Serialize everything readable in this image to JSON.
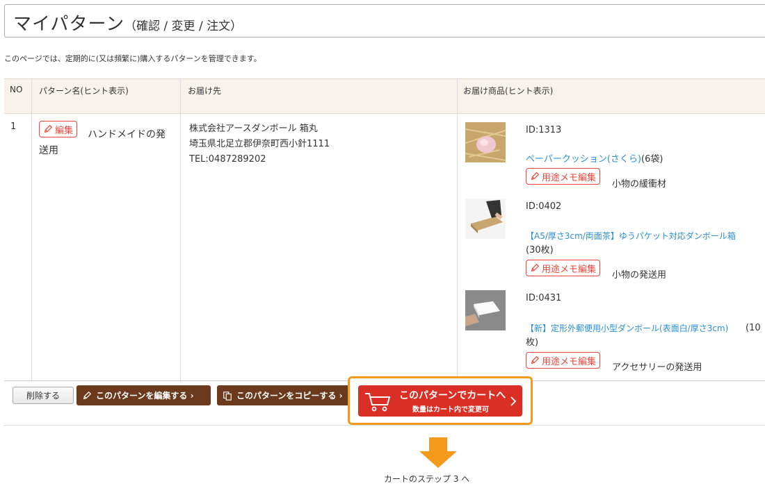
{
  "header": {
    "title": "マイパターン",
    "subtitle": "（確認 / 変更 / 注文）"
  },
  "description": "このページでは、定期的に(又は頻繁に)購入するパターンを管理できます。",
  "table": {
    "headers": {
      "no": "NO",
      "pattern_name": "パターン名(ヒント表示)",
      "destination": "お届け先",
      "products": "お届け商品(ヒント表示)"
    },
    "row": {
      "no": "1",
      "edit_label": "編集",
      "pattern_name_line1": "ハンドメイドの発",
      "pattern_name_line2": "送用",
      "destination": {
        "company": "株式会社アースダンボール 箱丸",
        "address": "埼玉県北足立郡伊奈町西小針1111",
        "tel": "TEL:0487289202"
      },
      "products": [
        {
          "id": "ID:1313",
          "name": "ペーパークッション(さくら)",
          "qty": "(6袋)",
          "memo_btn": "用途メモ編集",
          "memo": "小物の緩衝材"
        },
        {
          "id": "ID:0402",
          "name": "【A5/厚さ3cm/両面茶】ゆうパケット対応ダンボール箱",
          "qty": "(30枚)",
          "memo_btn": "用途メモ編集",
          "memo": "小物の発送用"
        },
        {
          "id": "ID:0431",
          "name": "【新】定形外郵便用小型ダンボール(表面白/厚さ3cm)",
          "qty_a": "(10",
          "qty_b": "枚)",
          "memo_btn": "用途メモ編集",
          "memo": "アクセサリーの発送用"
        }
      ]
    }
  },
  "actions": {
    "delete": "削除する",
    "edit_pattern": "このパターンを編集する ›",
    "copy_pattern": "このパターンをコピーする ›",
    "cart_main": "このパターンでカートへ",
    "cart_sub": "数量はカート内で変更可"
  },
  "step_label": "カートのステップ 3 へ",
  "colors": {
    "accent_red": "#d92f24",
    "brown": "#6b3a1d",
    "highlight_orange": "#f39a1c",
    "link_blue": "#2a8fd0"
  }
}
